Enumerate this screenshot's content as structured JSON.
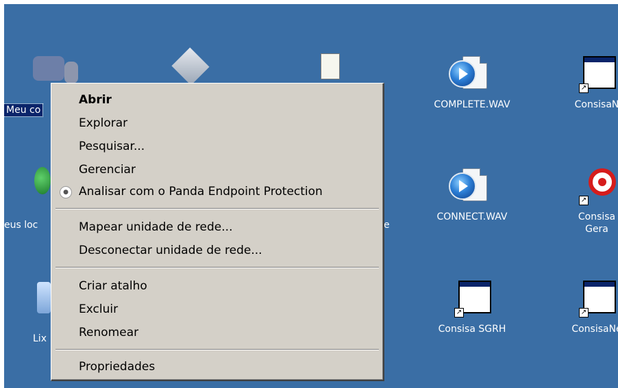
{
  "desktop": {
    "background": "#3a6ea5",
    "icons": {
      "my_computer": "Meu co",
      "network": "eus loc",
      "recycle": "Lix",
      "e_fragment": "e",
      "complete_wav": "COMPLETE.WAV",
      "connect_wav": "CONNECT.WAV",
      "consisa_ne_top": "ConsisaN",
      "consisa_gera_l1": "Consisa",
      "consisa_gera_l2": "Gera",
      "consisa_sgrh": "Consisa SGRH",
      "consisa_ne_bottom": "ConsisaNe"
    }
  },
  "context_menu": {
    "items": {
      "open": "Abrir",
      "explore": "Explorar",
      "search": "Pesquisar...",
      "manage": "Gerenciar",
      "scan_panda": "Analisar com o Panda Endpoint Protection",
      "map_drive": "Mapear unidade de rede...",
      "disconnect_drive": "Desconectar unidade de rede...",
      "create_shortcut": "Criar atalho",
      "delete": "Excluir",
      "rename": "Renomear",
      "properties": "Propriedades"
    }
  }
}
